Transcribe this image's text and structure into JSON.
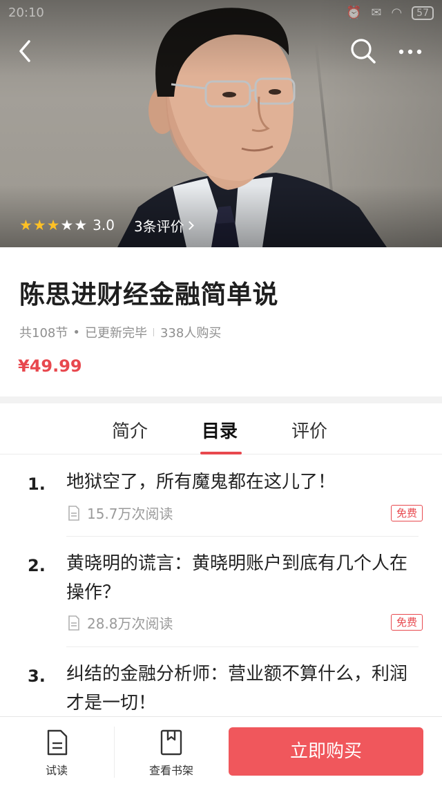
{
  "status_bar": {
    "time": "20:10",
    "battery": "57"
  },
  "hero": {
    "rating": {
      "value": 3,
      "max": 5,
      "score_text": "3.0",
      "reviews_text": "3条评价"
    }
  },
  "course": {
    "title": "陈思进财经金融简单说",
    "sections": "共108节",
    "dot": "•",
    "status": "已更新完毕",
    "buyers": "338人购买",
    "price": "¥49.99"
  },
  "tabs": [
    "简介",
    "目录",
    "评价"
  ],
  "active_tab": "目录",
  "chapters": [
    {
      "num": "1.",
      "title": "地狱空了，所有魔鬼都在这儿了！",
      "reads": "15.7万次阅读",
      "badge": "免费"
    },
    {
      "num": "2.",
      "title": "黄晓明的谎言：黄晓明账户到底有几个人在操作？",
      "reads": "28.8万次阅读",
      "badge": "免费"
    },
    {
      "num": "3.",
      "title": "纠结的金融分析师：营业额不算什么，利润才是一切！",
      "reads": "",
      "badge": ""
    }
  ],
  "bottom_bar": {
    "trial": "试读",
    "shelf": "查看书架",
    "buy": "立即购买"
  },
  "colors": {
    "accent": "#e8484e",
    "button": "#f0575c",
    "star": "#ffc125"
  },
  "icons": [
    "back-arrow-icon",
    "search-icon",
    "more-icon",
    "star-icon",
    "document-icon",
    "bookmark-icon"
  ]
}
